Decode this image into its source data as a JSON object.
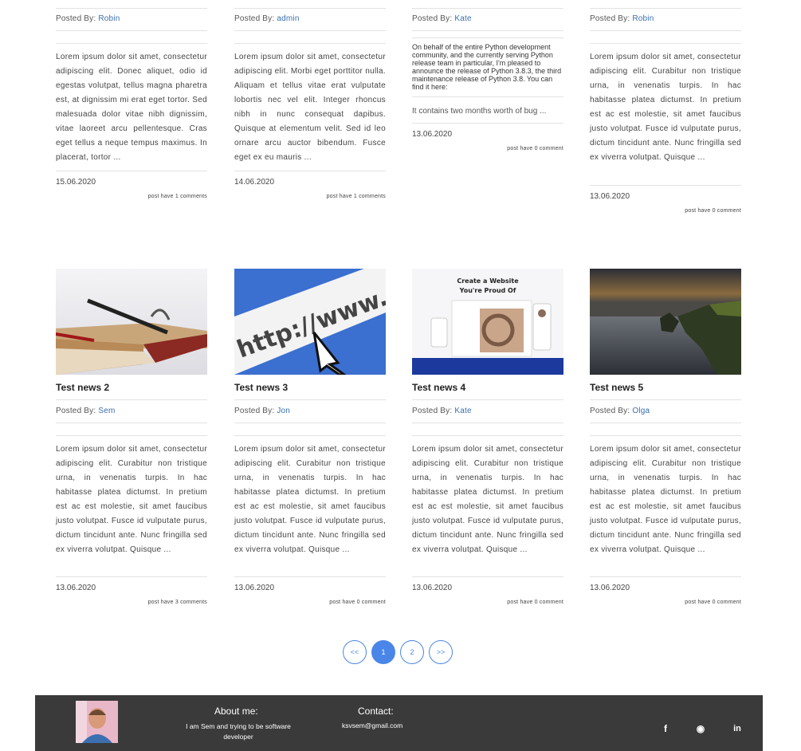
{
  "top_posts": [
    {
      "posted_by_label": "Posted By:",
      "author": "Robin",
      "excerpt": "Lorem ipsum dolor sit amet, consectetur adipiscing elit. Donec aliquet, odio id egestas volutpat, tellus magna pharetra est, at dignissim mi erat eget tortor. Sed malesuada dolor vitae nibh dignissim, vitae laoreet arcu pellentesque. Cras eget tellus a neque tempus maximus. In placerat, tortor ...",
      "date": "15.06.2020",
      "comments": "post have 1 comments"
    },
    {
      "posted_by_label": "Posted By:",
      "author": "admin",
      "excerpt": "Lorem ipsum dolor sit amet, consectetur adipiscing elit. Morbi eget porttitor nulla. Aliquam et tellus vitae erat vulputate lobortis nec vel elit. Integer rhoncus nibh in nunc consequat dapibus. Quisque at elementum velit. Sed id leo ornare arcu auctor bibendum. Fusce eget ex eu mauris ...",
      "date": "14.06.2020",
      "comments": "post have 1 comments"
    },
    {
      "posted_by_label": "Posted By:",
      "author": "Kate",
      "excerpt": "On behalf of the entire Python development community, and the currently serving Python release team in particular, I'm pleased to announce the release of Python 3.8.3, the third maintenance release of Python 3.8. You can find it here:",
      "excerpt_tail": "It contains two months worth of bug ...",
      "date": "13.06.2020",
      "comments": "post have 0 comment"
    },
    {
      "posted_by_label": "Posted By:",
      "author": "Robin",
      "excerpt": "Lorem ipsum dolor sit amet, consectetur adipiscing elit. Curabitur non tristique urna, in venenatis turpis. In hac habitasse platea dictumst. In pretium est ac est molestie, sit amet faucibus justo volutpat. Fusce id vulputate purus, dictum tincidunt ante. Nunc fringilla sed ex viverra volutpat. Quisque ...",
      "date": "13.06.2020",
      "comments": "post have 0 comment"
    }
  ],
  "bottom_posts": [
    {
      "title": "Test news 2",
      "posted_by_label": "Posted By:",
      "author": "Sem",
      "image": "pen-and-notebook",
      "excerpt": "Lorem ipsum dolor sit amet, consectetur adipiscing elit. Curabitur non tristique urna, in venenatis turpis. In hac habitasse platea dictumst. In pretium est ac est molestie, sit amet faucibus justo volutpat. Fusce id vulputate purus, dictum tincidunt ante. Nunc fringilla sed ex viverra volutpat. Quisque ...",
      "date": "13.06.2020",
      "comments": "post have 3 comments"
    },
    {
      "title": "Test news 3",
      "posted_by_label": "Posted By:",
      "author": "Jon",
      "image": "http-address-bar",
      "image_text": "http://www.",
      "excerpt": "Lorem ipsum dolor sit amet, consectetur adipiscing elit. Curabitur non tristique urna, in venenatis turpis. In hac habitasse platea dictumst. In pretium est ac est molestie, sit amet faucibus justo volutpat. Fusce id vulputate purus, dictum tincidunt ante. Nunc fringilla sed ex viverra volutpat. Quisque ...",
      "date": "13.06.2020",
      "comments": "post have 0 comment"
    },
    {
      "title": "Test news 4",
      "posted_by_label": "Posted By:",
      "author": "Kate",
      "image": "website-builder-mockup",
      "image_text_1": "Create a Website",
      "image_text_2": "You're Proud Of",
      "excerpt": "Lorem ipsum dolor sit amet, consectetur adipiscing elit. Curabitur non tristique urna, in venenatis turpis. In hac habitasse platea dictumst. In pretium est ac est molestie, sit amet faucibus justo volutpat. Fusce id vulputate purus, dictum tincidunt ante. Nunc fringilla sed ex viverra volutpat. Quisque ...",
      "date": "13.06.2020",
      "comments": "post have 0 comment"
    },
    {
      "title": "Test news 5",
      "posted_by_label": "Posted By:",
      "author": "Olga",
      "image": "coastal-cliffs-sunset",
      "excerpt": "Lorem ipsum dolor sit amet, consectetur adipiscing elit. Curabitur non tristique urna, in venenatis turpis. In hac habitasse platea dictumst. In pretium est ac est molestie, sit amet faucibus justo volutpat. Fusce id vulputate purus, dictum tincidunt ante. Nunc fringilla sed ex viverra volutpat. Quisque ...",
      "date": "13.06.2020",
      "comments": "post have 0 comment"
    }
  ],
  "pagination": {
    "prev": "<<",
    "pages": [
      "1",
      "2"
    ],
    "active": "1",
    "next": ">>"
  },
  "footer": {
    "about_title": "About me:",
    "about_text": "I am Sem and trying to be software developer",
    "contact_title": "Contact:",
    "contact_email": "ksvsem@gmail.com",
    "social": [
      {
        "icon": "facebook-icon",
        "glyph": "f"
      },
      {
        "icon": "github-icon",
        "glyph": "◉"
      },
      {
        "icon": "linkedin-icon",
        "glyph": "in"
      }
    ]
  },
  "colors": {
    "accent": "#4a86e8",
    "author_link": "#3a6fb0",
    "footer_bg": "#3a3a3a"
  }
}
